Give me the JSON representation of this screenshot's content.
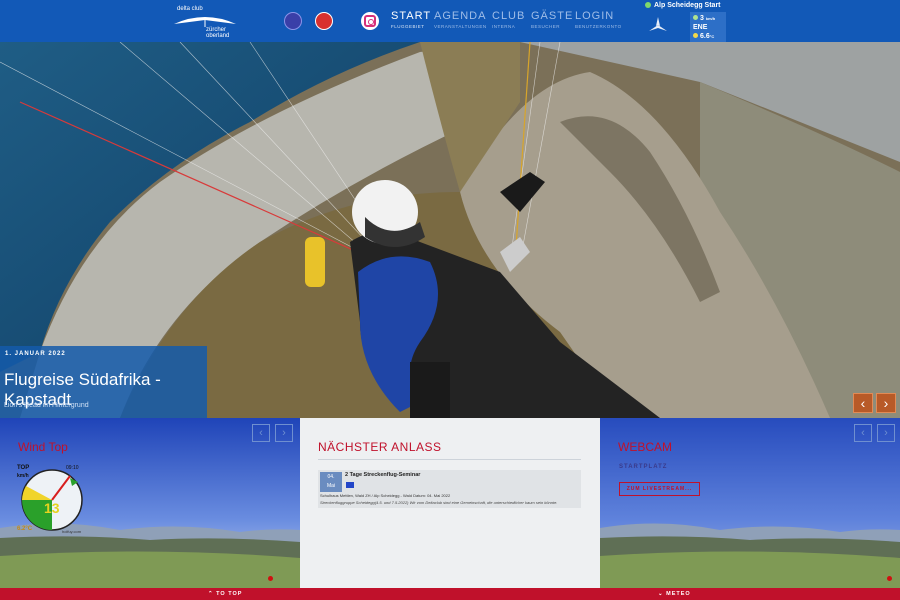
{
  "logo": {
    "line1": "delta club",
    "line2": "zürcher oberland"
  },
  "nav": [
    {
      "label": "START",
      "sub": "FLUGGEBIET"
    },
    {
      "label": "AGENDA",
      "sub": "VERANSTALTUNGEN"
    },
    {
      "label": "CLUB",
      "sub": "INTERNA"
    },
    {
      "label": "GÄSTE",
      "sub": "BESUCHER"
    },
    {
      "label": "LOGIN",
      "sub": "BENUTZERKONTO"
    }
  ],
  "station": {
    "name": "Alp Scheidegg Start",
    "speed": "3",
    "speed_unit": "km/h",
    "direction": "ENE",
    "temp": "6.6",
    "temp_unit": "°C"
  },
  "hero": {
    "date": "1. JANUAR 2022",
    "title": "Flugreise Südafrika - Kapstadt",
    "subtitle": "Lion's Head im Hintergrund",
    "prev": "‹",
    "next": "›"
  },
  "wind_top": {
    "title": "Wind Top",
    "label": "TOP",
    "unit": "km/h",
    "right_label": "09:10",
    "value": "13",
    "temp": "6.2°C",
    "footer": "holfuy.com"
  },
  "event_panel": {
    "title": "NÄCHSTER ANLASS",
    "event": {
      "cal_day": "04.",
      "cal_month": "Mai",
      "title": "2 Tage Streckenflug-Seminar",
      "meta": "Schulhaus Mettlen, Wald ZH / Alp Scheidegg - Wald Datum: 04. Mai 2022",
      "desc": "Streckenfluggruppe Scheidegg(4.5. und 7.5.2022) Wir vom Deltaclub sind eine Gemeinschaft, die unterschiedlicher kaum sein könnte."
    }
  },
  "webcam": {
    "title": "WEBCAM",
    "subtitle": "STARTPLATZ",
    "button": "ZUM LIVESTREAM..."
  },
  "footer": {
    "left": "TO TOP",
    "right": "METEO"
  },
  "colors": {
    "header": "#1259b7",
    "accent": "#c0112b",
    "caption": "#145aaa"
  }
}
